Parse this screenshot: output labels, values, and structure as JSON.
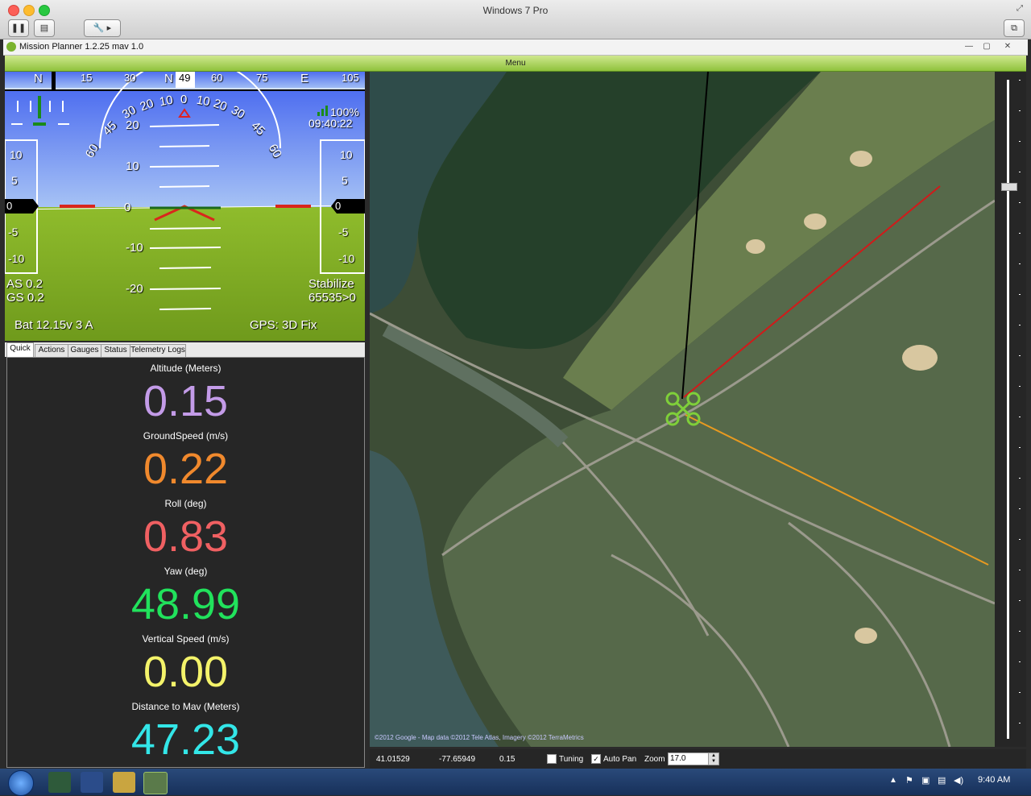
{
  "window": {
    "mac_title": "Windows 7 Pro",
    "app_title": "Mission Planner 1.2.25 mav 1.0",
    "menu_label": "Menu"
  },
  "hud": {
    "heading_ticks": [
      "N",
      "15",
      "30",
      "N",
      "49",
      "60",
      "75",
      "E",
      "105"
    ],
    "heading_value": "49",
    "pitch_labels": [
      "20",
      "10",
      "0",
      "-10",
      "-20"
    ],
    "roll_labels": [
      "60",
      "45",
      "30",
      "20",
      "10",
      "0",
      "10",
      "20",
      "30",
      "45",
      "60"
    ],
    "left_tape": [
      "10",
      "5",
      "0",
      "-5",
      "-10"
    ],
    "right_tape": [
      "10",
      "5",
      "0",
      "-5",
      "-10"
    ],
    "left_tape_value": "0",
    "right_tape_value": "0",
    "battery_pct": "100%",
    "clock": "09:40:22",
    "airspeed": "AS 0.2",
    "groundspeed": "GS 0.2",
    "mode": "Stabilize",
    "wp_info": "65535>0",
    "battery": "Bat 12.15v 3 A",
    "gps": "GPS: 3D Fix",
    "colors": {
      "sky": "#6f8ff3",
      "ground": "#8fbc2c",
      "horizon_red": "#d9261c"
    }
  },
  "tabs": [
    {
      "label": "Quick",
      "active": true
    },
    {
      "label": "Actions",
      "active": false
    },
    {
      "label": "Gauges",
      "active": false
    },
    {
      "label": "Status",
      "active": false
    },
    {
      "label": "Telemetry Logs",
      "active": false
    }
  ],
  "quick": [
    {
      "label": "Altitude (Meters)",
      "value": "0.15",
      "color": "#c39be8"
    },
    {
      "label": "GroundSpeed (m/s)",
      "value": "0.22",
      "color": "#f0892d"
    },
    {
      "label": "Roll (deg)",
      "value": "0.83",
      "color": "#f06062"
    },
    {
      "label": "Yaw (deg)",
      "value": "48.99",
      "color": "#21e25c"
    },
    {
      "label": "Vertical Speed (m/s)",
      "value": "0.00",
      "color": "#f4f36a"
    },
    {
      "label": "Distance to Mav (Meters)",
      "value": "47.23",
      "color": "#33e6e8"
    }
  ],
  "map": {
    "copyright": "©2012 Google - Map data ©2012 Tele Atlas, Imagery ©2012 TerraMetrics"
  },
  "status": {
    "lat": "41.01529",
    "lng": "-77.65949",
    "alt": "0.15",
    "tuning_label": "Tuning",
    "tuning_checked": false,
    "autopan_label": "Auto Pan",
    "autopan_checked": true,
    "zoom_label": "Zoom",
    "zoom_value": "17.0"
  },
  "taskbar": {
    "clock": "9:40 AM"
  }
}
